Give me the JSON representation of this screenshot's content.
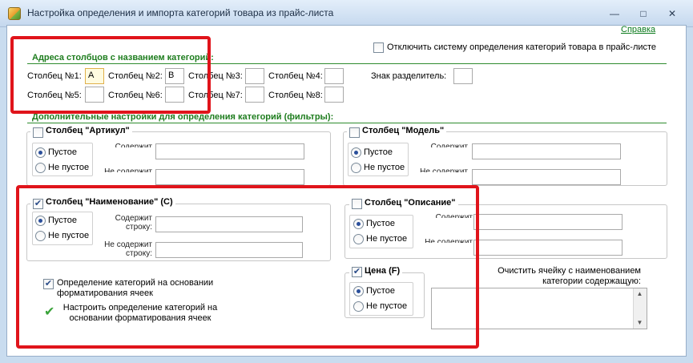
{
  "window": {
    "title": "Настройка определения и импорта категорий товара из прайс-листа",
    "help_link": "Справка"
  },
  "disable_system": {
    "label": "Отключить систему определения категорий товара в прайс-листе",
    "checked": false
  },
  "columns_section": {
    "title": "Адреса столбцов с названием категорий:",
    "fields": [
      {
        "label": "Столбец №1:",
        "value": "A"
      },
      {
        "label": "Столбец №2:",
        "value": "B"
      },
      {
        "label": "Столбец №3:",
        "value": ""
      },
      {
        "label": "Столбец №4:",
        "value": ""
      },
      {
        "label": "Столбец №5:",
        "value": ""
      },
      {
        "label": "Столбец №6:",
        "value": ""
      },
      {
        "label": "Столбец №7:",
        "value": ""
      },
      {
        "label": "Столбец №8:",
        "value": ""
      }
    ],
    "separator_label": "Знак разделитель:",
    "separator_value": ""
  },
  "filters_section": {
    "title": "Дополнительные настройки для определения категорий (фильтры):"
  },
  "radio_labels": {
    "empty": "Пустое",
    "not_empty": "Не пустое"
  },
  "filter_labels": {
    "contains_1": "Содержит",
    "contains_2": "строку:",
    "not_contains_1": "Не содержит",
    "not_contains_2": "строку:"
  },
  "article": {
    "title": "Столбец \"Артикул\"",
    "checked": false,
    "selected": "empty",
    "contains": "",
    "not_contains": ""
  },
  "model": {
    "title": "Столбец \"Модель\"",
    "checked": false,
    "selected": "empty",
    "contains": "",
    "not_contains": ""
  },
  "name": {
    "title": "Столбец \"Наименование\" (C)",
    "checked": true,
    "selected": "empty",
    "contains": "",
    "not_contains": ""
  },
  "description": {
    "title": "Столбец \"Описание\"",
    "checked": false,
    "selected": "empty",
    "contains": "",
    "not_contains": ""
  },
  "price": {
    "title": "Цена (F)",
    "checked": true,
    "selected": "empty"
  },
  "formatting": {
    "checkbox_label_1": "Определение категорий на основании",
    "checkbox_label_2": "форматирования ячеек",
    "checked": true,
    "link_label_1": "Настроить определение категорий на",
    "link_label_2": "основании форматирования ячеек"
  },
  "clear_cell": {
    "label_1": "Очистить ячейку с наименованием",
    "label_2": "категории содержащую:",
    "value": ""
  },
  "colors": {
    "accent_green": "#1e7d1e",
    "highlight_red": "#e0141b",
    "check_blue": "#2b4d8a"
  }
}
